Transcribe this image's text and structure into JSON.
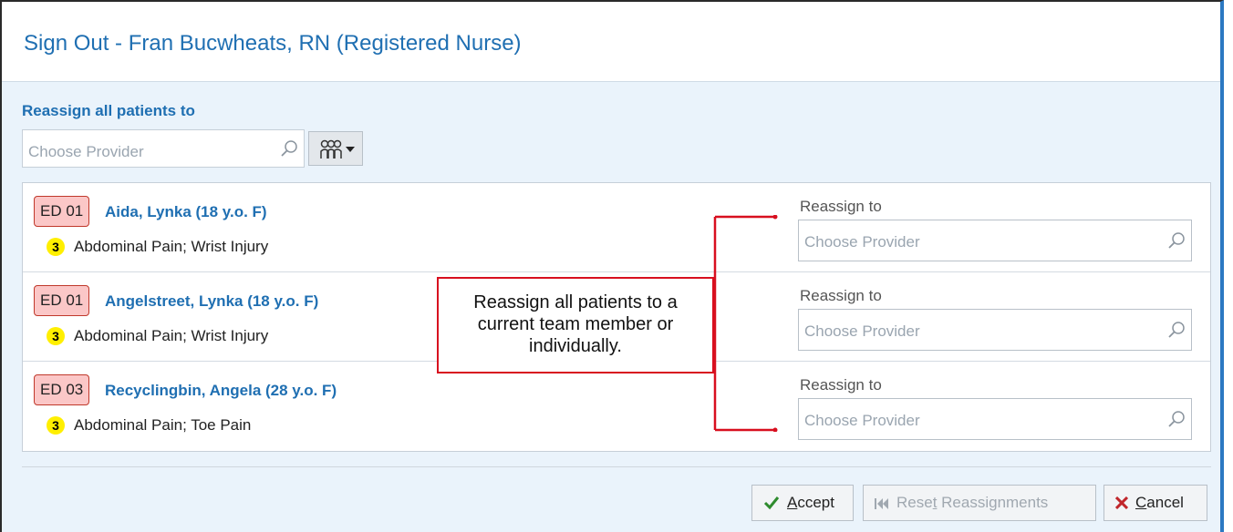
{
  "dialog": {
    "title": "Sign Out - Fran Bucwheats, RN (Registered Nurse)"
  },
  "reassign_all": {
    "label": "Reassign all patients to",
    "placeholder": "Choose Provider",
    "team_button_icon": "team-icon"
  },
  "patients": [
    {
      "room": "ED 01",
      "name": "Aida, Lynka (18 y.o. F)",
      "acuity": "3",
      "complaint": "Abdominal Pain; Wrist Injury",
      "reassign_label": "Reassign to",
      "reassign_placeholder": "Choose Provider"
    },
    {
      "room": "ED 01",
      "name": "Angelstreet, Lynka (18 y.o. F)",
      "acuity": "3",
      "complaint": "Abdominal Pain; Wrist Injury",
      "reassign_label": "Reassign to",
      "reassign_placeholder": "Choose Provider"
    },
    {
      "room": "ED 03",
      "name": "Recyclingbin, Angela (28 y.o. F)",
      "acuity": "3",
      "complaint": "Abdominal Pain; Toe Pain",
      "reassign_label": "Reassign to",
      "reassign_placeholder": "Choose Provider"
    }
  ],
  "callout": {
    "text": "Reassign all patients to a\ncurrent team member or\nindividually."
  },
  "buttons": {
    "accept_pre": "",
    "accept_key": "A",
    "accept_post": "ccept",
    "reset_pre": "Rese",
    "reset_key": "t",
    "reset_post": " Reassignments",
    "cancel_pre": "",
    "cancel_key": "C",
    "cancel_post": "ancel"
  },
  "colors": {
    "accent": "#1f6fb2",
    "room_badge_bg": "#fbc7c7",
    "acuity_bg": "#ffef00",
    "callout_red": "#d80f1f",
    "accept_check": "#2e8b2e",
    "cancel_x": "#c0262b"
  }
}
